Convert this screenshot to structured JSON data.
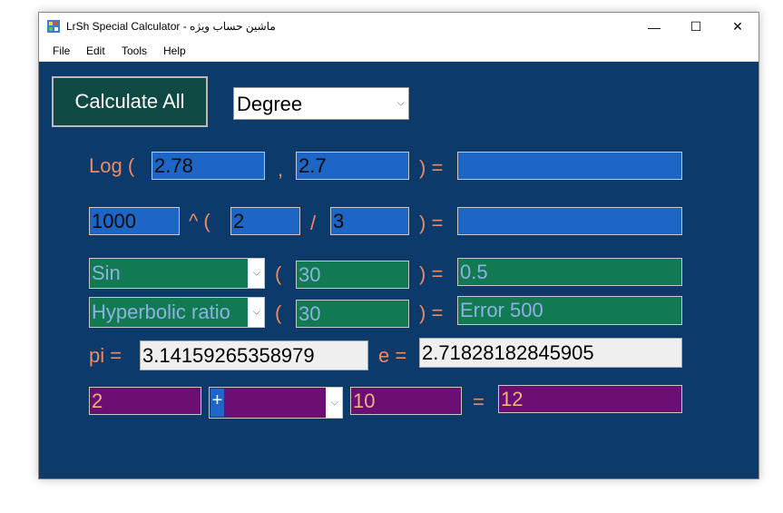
{
  "window": {
    "title": "LrSh Special Calculator - ماشین حساب ویژه",
    "minimize_glyph": "—",
    "maximize_glyph": "☐",
    "close_glyph": "✕"
  },
  "menu": [
    "File",
    "Edit",
    "Tools",
    "Help"
  ],
  "toolbar": {
    "calculate_label": "Calculate All",
    "angle_mode": "Degree"
  },
  "log_row": {
    "prefix": "Log (",
    "value": "2.78",
    "comma": ",",
    "base": "2.7",
    "equals": ") =",
    "result": ""
  },
  "power_row": {
    "base": "1000",
    "op": "^ (",
    "numerator": "2",
    "slash": "/",
    "denominator": "3",
    "equals": ") =",
    "result": ""
  },
  "trig_row": {
    "function": "Sin",
    "open": "(",
    "argument": "30",
    "equals": ") =",
    "result": "0.5"
  },
  "hyper_row": {
    "function": "Hyperbolic ratio",
    "open": "(",
    "argument": "30",
    "equals": ") =",
    "result": "Error 500"
  },
  "constants": {
    "pi_label": "pi =",
    "pi_value": "3.14159265358979",
    "e_label": "e =",
    "e_value": "2.71828182845905"
  },
  "arith_row": {
    "left": "2",
    "operator": "+",
    "right": "10",
    "equals": "=",
    "result": "12"
  },
  "colors": {
    "background": "#0b3a6b",
    "label": "#ef8a66",
    "blue_field": "#1e66c6",
    "green_field": "#127a52",
    "purple_field": "#6b0f74"
  }
}
